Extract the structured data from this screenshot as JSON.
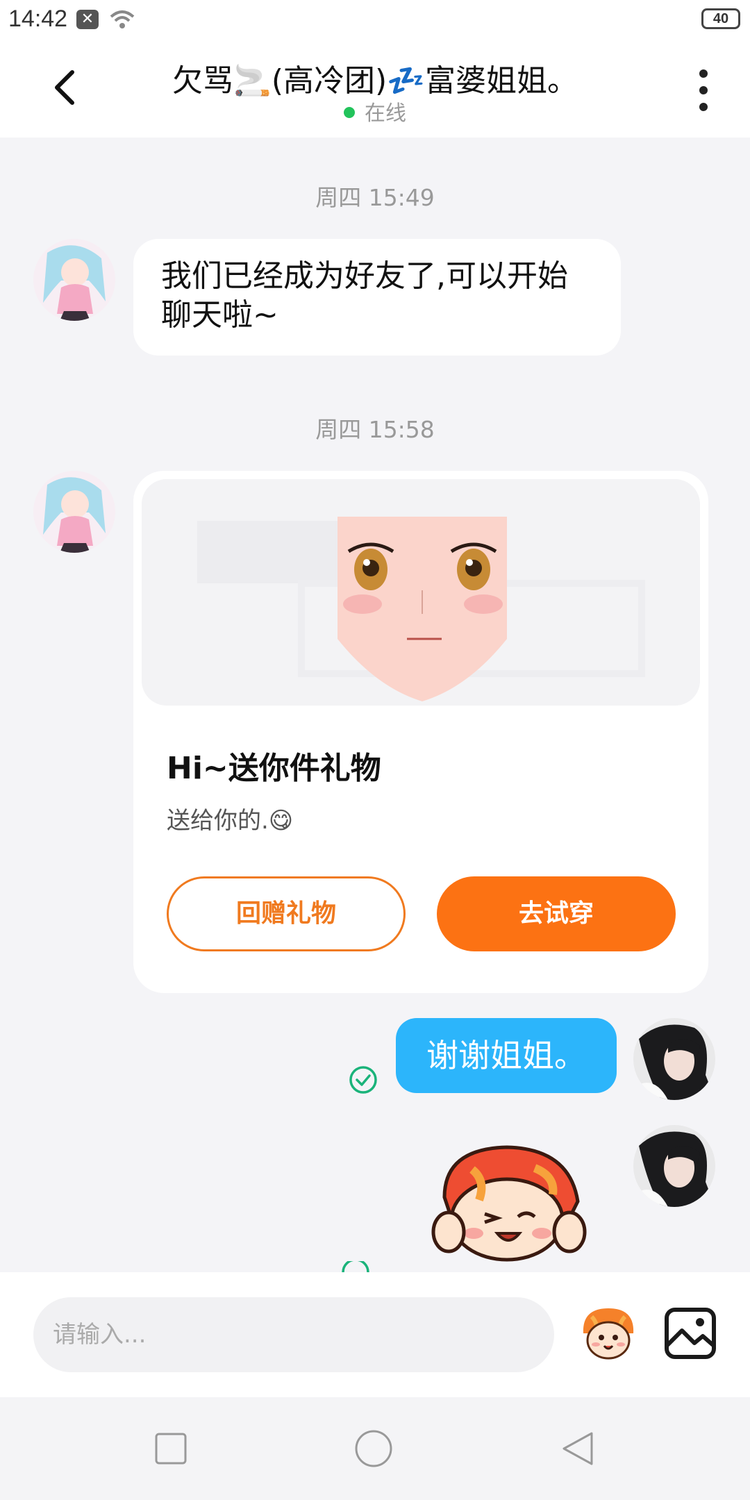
{
  "status_bar": {
    "time": "14:42",
    "battery": "40"
  },
  "header": {
    "title": "欠骂🚬(高冷团)💤富婆姐姐。",
    "status": "在线"
  },
  "messages": [
    {
      "timestamp": "周四 15:49",
      "text": "我们已经成为好友了,可以开始聊天啦~"
    },
    {
      "timestamp": "周四 15:58",
      "gift_title": "Hi~送你件礼物",
      "gift_desc": "送给你的.😋",
      "return_button": "回赠礼物",
      "try_button": "去试穿"
    },
    {
      "text": "谢谢姐姐。"
    }
  ],
  "input": {
    "placeholder": "请输入..."
  },
  "colors": {
    "accent": "#fc7213",
    "bubble_blue": "#2cb5fb",
    "online": "#22c35b"
  },
  "icons": [
    "back-icon",
    "more-icon",
    "check-icon",
    "emoji-icon",
    "image-icon",
    "square-nav-icon",
    "circle-nav-icon",
    "back-triangle-icon"
  ]
}
